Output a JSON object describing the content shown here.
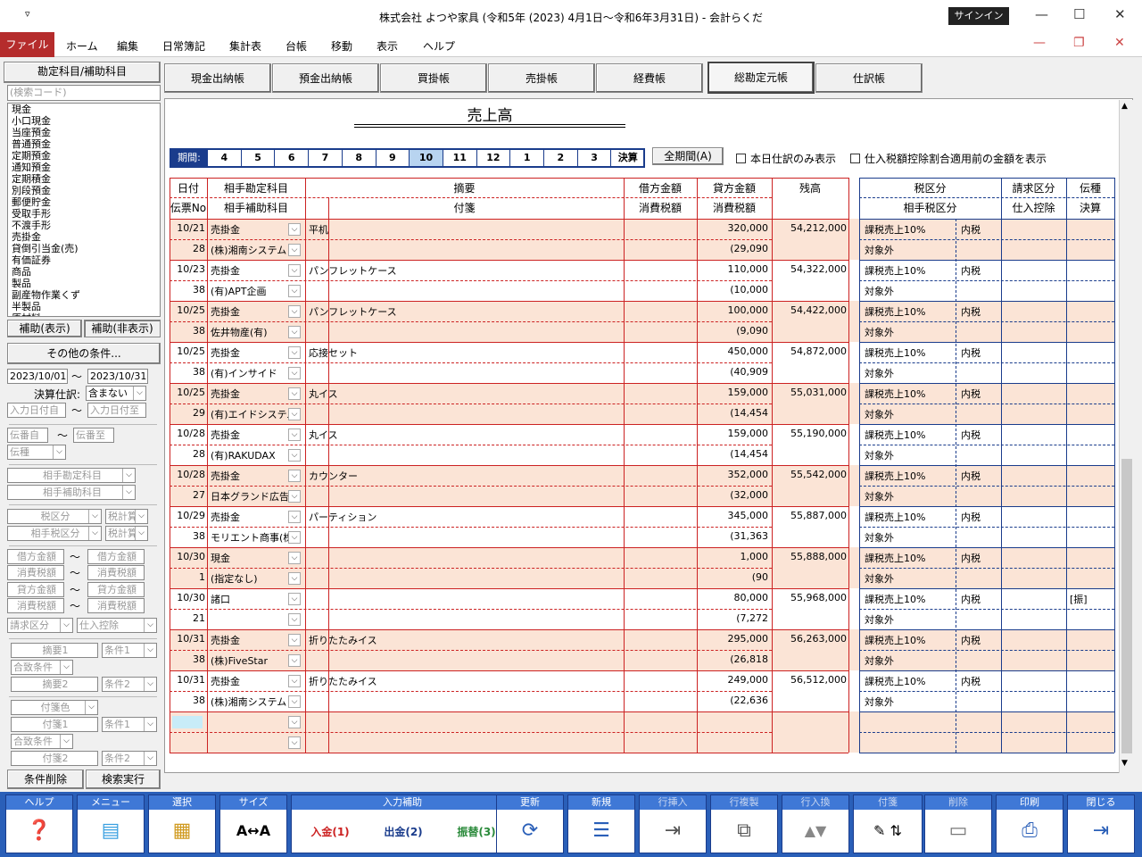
{
  "window": {
    "title": "株式会社 よつや家具 (令和5年 (2023) 4月1日～令和6年3月31日) - 会計らくだ",
    "signin": "サインイン",
    "qa": "▿"
  },
  "menu": [
    "ファイル",
    "ホーム",
    "編集",
    "日常簿記",
    "集計表",
    "台帳",
    "移動",
    "表示",
    "ヘルプ"
  ],
  "left": {
    "header": "勘定科目/補助科目",
    "search_placeholder": "(検索コード)",
    "accounts": [
      "現金",
      "小口現金",
      "当座預金",
      "普通預金",
      "定期預金",
      "通知預金",
      "定期積金",
      "別段預金",
      "郵便貯金",
      "受取手形",
      "不渡手形",
      "売掛金",
      "貸倒引当金(売)",
      "有価証券",
      "商品",
      "製品",
      "副産物作業くず",
      "半製品",
      "原材料"
    ],
    "btn_show": "補助(表示)",
    "btn_hide": "補助(非表示)",
    "other_cond": "その他の条件...",
    "date_from": "2023/10/01",
    "date_to": "2023/10/31",
    "tilde": "～",
    "kessan_label": "決算仕訳:",
    "kessan_value": "含まない",
    "entry_from": "入力日付自",
    "entry_to": "入力日付至",
    "slip_from": "伝番自",
    "slip_to": "伝番至",
    "denshu": "伝種",
    "aite_kamoku": "相手勘定科目",
    "aite_hojo": "相手補助科目",
    "zei": "税区分",
    "zei_c": "税計算",
    "aite_zei": "相手税区分",
    "aite_zei_c": "税計算",
    "kari": "借方金額",
    "kari2": "借方金額",
    "shohi1": "消費税額",
    "shohi1b": "消費税額",
    "kashi": "貸方金額",
    "kashi2": "貸方金額",
    "shohi2": "消費税額",
    "shohi2b": "消費税額",
    "seikyu": "請求区分",
    "shiire": "仕入控除",
    "tekiyo1": "摘要1",
    "joken1": "条件1",
    "gatchi1": "合致条件",
    "tekiyo2": "摘要2",
    "joken2": "条件2",
    "fusen_color": "付箋色",
    "fusen1": "付箋1",
    "joken3": "条件1",
    "gatchi2": "合致条件",
    "fusen2": "付箋2",
    "joken4": "条件2",
    "clear": "条件削除",
    "search": "検索実行"
  },
  "tabs": [
    "現金出納帳",
    "預金出納帳",
    "買掛帳",
    "売掛帳",
    "経費帳",
    "総勘定元帳",
    "仕訳帳"
  ],
  "active_tab": 5,
  "ledger": {
    "title": "売上高",
    "period_label": "期間:",
    "periods": [
      "4",
      "5",
      "6",
      "7",
      "8",
      "9",
      "10",
      "11",
      "12",
      "1",
      "2",
      "3",
      "決算"
    ],
    "selected_period": "10",
    "all_period": "全期間(A)",
    "chk_today": "本日仕訳のみ表示",
    "chk_shiire": "仕入税額控除割合適用前の金額を表示",
    "headers": {
      "date": "日付",
      "slip": "伝票No",
      "aite": "相手勘定科目",
      "aite_hojo": "相手補助科目",
      "tekiyo": "摘要",
      "fusen": "付箋",
      "kari": "借方金額",
      "kari_tax": "消費税額",
      "kashi": "貸方金額",
      "kashi_tax": "消費税額",
      "zandaka": "残高",
      "zei": "税区分",
      "aite_zei": "相手税区分",
      "seikyu": "請求区分",
      "shiire": "仕入控除",
      "denshu": "伝種",
      "kessan": "決算"
    },
    "rows": [
      {
        "date": "10/21",
        "slip": "28",
        "acct": "売掛金",
        "sub": "(株)湘南システム",
        "memo": "平机",
        "credit": "320,000",
        "tax": "(29,090",
        "balance": "54,212,000",
        "zei": "課税売上10%",
        "uchi": "内税",
        "aite_zei": "対象外",
        "den": ""
      },
      {
        "date": "10/23",
        "slip": "38",
        "acct": "売掛金",
        "sub": "(有)APT企画",
        "memo": "パンフレットケース",
        "credit": "110,000",
        "tax": "(10,000",
        "balance": "54,322,000",
        "zei": "課税売上10%",
        "uchi": "内税",
        "aite_zei": "対象外",
        "den": ""
      },
      {
        "date": "10/25",
        "slip": "38",
        "acct": "売掛金",
        "sub": "佐井物産(有)",
        "memo": "パンフレットケース",
        "credit": "100,000",
        "tax": "(9,090",
        "balance": "54,422,000",
        "zei": "課税売上10%",
        "uchi": "内税",
        "aite_zei": "対象外",
        "den": ""
      },
      {
        "date": "10/25",
        "slip": "38",
        "acct": "売掛金",
        "sub": "(有)インサイド",
        "memo": "応接セット",
        "credit": "450,000",
        "tax": "(40,909",
        "balance": "54,872,000",
        "zei": "課税売上10%",
        "uchi": "内税",
        "aite_zei": "対象外",
        "den": ""
      },
      {
        "date": "10/25",
        "slip": "29",
        "acct": "売掛金",
        "sub": "(有)エイドシステム",
        "memo": "丸イス",
        "credit": "159,000",
        "tax": "(14,454",
        "balance": "55,031,000",
        "zei": "課税売上10%",
        "uchi": "内税",
        "aite_zei": "対象外",
        "den": ""
      },
      {
        "date": "10/28",
        "slip": "28",
        "acct": "売掛金",
        "sub": "(有)RAKUDAX",
        "memo": "丸イス",
        "credit": "159,000",
        "tax": "(14,454",
        "balance": "55,190,000",
        "zei": "課税売上10%",
        "uchi": "内税",
        "aite_zei": "対象外",
        "den": ""
      },
      {
        "date": "10/28",
        "slip": "27",
        "acct": "売掛金",
        "sub": "日本グランド広告",
        "memo": "カウンター",
        "credit": "352,000",
        "tax": "(32,000",
        "balance": "55,542,000",
        "zei": "課税売上10%",
        "uchi": "内税",
        "aite_zei": "対象外",
        "den": ""
      },
      {
        "date": "10/29",
        "slip": "38",
        "acct": "売掛金",
        "sub": "モリエント商事(株)",
        "memo": "パーティション",
        "credit": "345,000",
        "tax": "(31,363",
        "balance": "55,887,000",
        "zei": "課税売上10%",
        "uchi": "内税",
        "aite_zei": "対象外",
        "den": ""
      },
      {
        "date": "10/30",
        "slip": "1",
        "acct": "現金",
        "sub": "(指定なし)",
        "memo": "",
        "credit": "1,000",
        "tax": "(90",
        "balance": "55,888,000",
        "zei": "課税売上10%",
        "uchi": "内税",
        "aite_zei": "対象外",
        "den": ""
      },
      {
        "date": "10/30",
        "slip": "21",
        "acct": "諸口",
        "sub": "",
        "memo": "",
        "credit": "80,000",
        "tax": "(7,272",
        "balance": "55,968,000",
        "zei": "課税売上10%",
        "uchi": "内税",
        "aite_zei": "対象外",
        "den": "[振]"
      },
      {
        "date": "10/31",
        "slip": "38",
        "acct": "売掛金",
        "sub": "(株)FiveStar",
        "memo": "折りたたみイス",
        "credit": "295,000",
        "tax": "(26,818",
        "balance": "56,263,000",
        "zei": "課税売上10%",
        "uchi": "内税",
        "aite_zei": "対象外",
        "den": ""
      },
      {
        "date": "10/31",
        "slip": "38",
        "acct": "売掛金",
        "sub": "(株)湘南システム",
        "memo": "折りたたみイス",
        "credit": "249,000",
        "tax": "(22,636",
        "balance": "56,512,000",
        "zei": "課税売上10%",
        "uchi": "内税",
        "aite_zei": "対象外",
        "den": ""
      }
    ]
  },
  "toolbar": {
    "help": "ヘルプ",
    "menu": "メニュー",
    "select": "選択",
    "size": "サイズ",
    "input_assist": "入力補助",
    "nyukin": "入金(1)",
    "shukkin": "出金(2)",
    "furikae": "振替(3)",
    "update": "更新",
    "new": "新規",
    "row_insert": "行挿入",
    "row_copy": "行複製",
    "row_swap": "行入換",
    "fusen": "付箋",
    "delete": "削除",
    "print": "印刷",
    "close": "閉じる"
  }
}
